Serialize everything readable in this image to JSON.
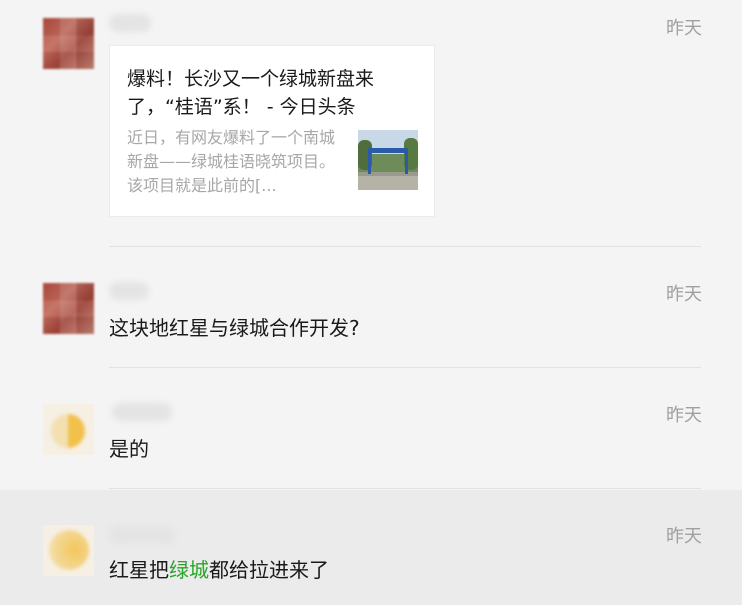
{
  "comments": [
    {
      "time": "昨天",
      "avatar": "red-pixel-avatar",
      "shared_link": {
        "title": "爆料！长沙又一个绿城新盘来了，“桂语”系！ - 今日头条",
        "description": "近日，有网友爆料了一个南城新盘——绿城桂语晓筑项目。该项目就是此前的[...",
        "thumbnail_icon": "gate-photo-thumbnail"
      }
    },
    {
      "time": "昨天",
      "avatar": "red-pixel-avatar",
      "text": "这块地红星与绿城合作开发?"
    },
    {
      "time": "昨天",
      "avatar": "sun-avatar",
      "text": "是的"
    },
    {
      "time": "昨天",
      "avatar": "sun-avatar",
      "text_parts": {
        "before": "红星把",
        "highlight": "绿城",
        "after": "都给拉进来了"
      }
    }
  ],
  "colors": {
    "background": "#f4f4f4",
    "highlight_row": "#ebebeb",
    "time_text": "#a0a0a0",
    "link_green": "#2aa42a"
  }
}
